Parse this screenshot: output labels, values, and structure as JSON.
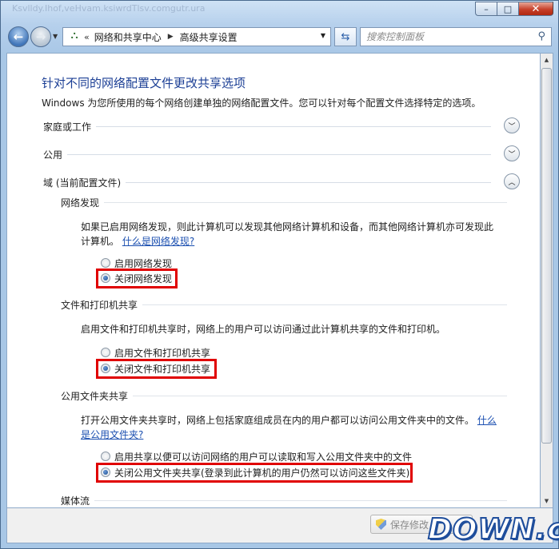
{
  "window": {
    "faded_title": "Ksvlldy.Ihof,veHvam.ksiwrdTlsv.comgutr.ura",
    "minimize_glyph": "–",
    "maximize_glyph": "□",
    "close_glyph": "✕"
  },
  "nav": {
    "back_glyph": "←",
    "forward_glyph": "→",
    "address_chevron": "«",
    "breadcrumbs": [
      "网络和共享中心",
      "高级共享设置"
    ],
    "crumb_separator": "▶",
    "refresh_glyph": "⇆",
    "search_placeholder": "搜索控制面板"
  },
  "page": {
    "title": "针对不同的网络配置文件更改共享选项",
    "description": "Windows 为您所使用的每个网络创建单独的网络配置文件。您可以针对每个配置文件选择特定的选项。"
  },
  "profiles": [
    {
      "label": "家庭或工作",
      "expanded": false
    },
    {
      "label": "公用",
      "expanded": false
    },
    {
      "label": "域 (当前配置文件)",
      "expanded": true
    }
  ],
  "network_discovery": {
    "heading": "网络发现",
    "desc_line1": "如果已启用网络发现，则此计算机可以发现其他网络计算机和设备，而其他网络计算机亦可发现此",
    "desc_line2": "计算机。",
    "link": "什么是网络发现?",
    "option_on": "启用网络发现",
    "option_off": "关闭网络发现",
    "selected": "off"
  },
  "file_printer": {
    "heading": "文件和打印机共享",
    "desc": "启用文件和打印机共享时，网络上的用户可以访问通过此计算机共享的文件和打印机。",
    "option_on": "启用文件和打印机共享",
    "option_off": "关闭文件和打印机共享",
    "selected": "off"
  },
  "public_folder": {
    "heading": "公用文件夹共享",
    "desc": "打开公用文件夹共享时，网络上包括家庭组成员在内的用户都可以访问公用文件夹中的文件。",
    "link_part1": "什么",
    "link_part2": "是公用文件夹?",
    "option_on": "启用共享以便可以访问网络的用户可以读取和写入公用文件夹中的文件",
    "option_off": "关闭公用文件夹共享(登录到此计算机的用户仍然可以访问这些文件夹)",
    "selected": "off"
  },
  "media": {
    "heading": "媒体流"
  },
  "footer": {
    "save_label": "保存修改"
  },
  "watermark": {
    "text": "DOWN.cc"
  },
  "colors": {
    "title_blue": "#1c3f95",
    "link_blue": "#1b4fb0",
    "highlight_red": "#e00000"
  }
}
